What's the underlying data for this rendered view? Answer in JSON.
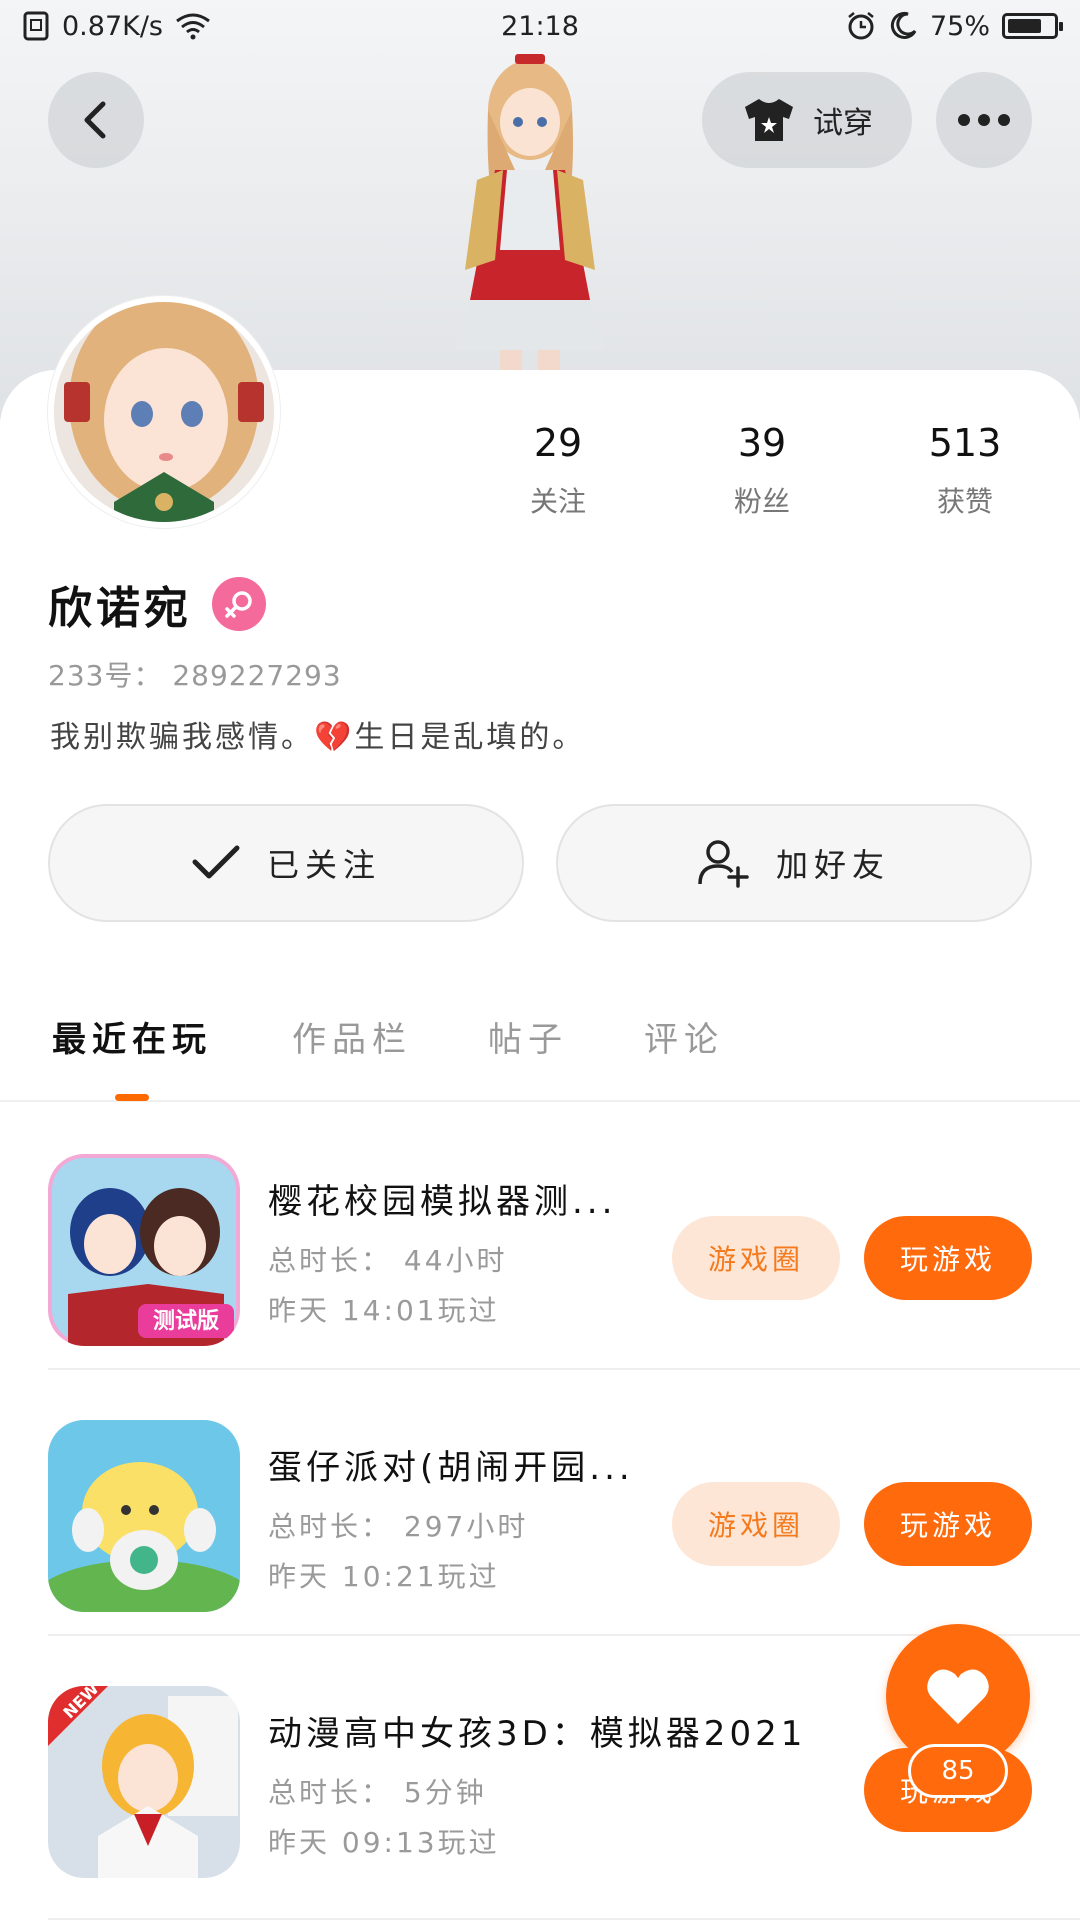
{
  "status_bar": {
    "network_speed": "0.87K/s",
    "time": "21:18",
    "battery": "75%",
    "battery_level": 0.75
  },
  "header": {
    "tryon_label": "试穿"
  },
  "profile": {
    "name": "欣诺宛",
    "uid": "233号： 289227293",
    "bio": "我别欺骗我感情。💔生日是乱填的。",
    "stats": [
      {
        "value": "29",
        "label": "关注"
      },
      {
        "value": "39",
        "label": "粉丝"
      },
      {
        "value": "513",
        "label": "获赞"
      }
    ]
  },
  "actions": {
    "followed_label": "已关注",
    "add_friend_label": "加好友"
  },
  "tabs": [
    {
      "label": "最近在玩",
      "active": true
    },
    {
      "label": "作品栏",
      "active": false
    },
    {
      "label": "帖子",
      "active": false
    },
    {
      "label": "评论",
      "active": false
    }
  ],
  "games": [
    {
      "title": "樱花校园模拟器测...",
      "total_time": "总时长： 44小时",
      "last_played": "昨天 14:01玩过",
      "circle_label": "游戏圈",
      "play_label": "玩游戏",
      "icon_badge": "测试版"
    },
    {
      "title": "蛋仔派对(胡闹开园...",
      "total_time": "总时长： 297小时",
      "last_played": "昨天 10:21玩过",
      "circle_label": "游戏圈",
      "play_label": "玩游戏",
      "icon_badge": ""
    },
    {
      "title": "动漫高中女孩3D：模拟器2021",
      "total_time": "总时长： 5分钟",
      "last_played": "昨天 09:13玩过",
      "circle_label": "",
      "play_label": "玩游戏",
      "icon_badge": "NEW"
    }
  ],
  "like": {
    "count": "85"
  },
  "colors": {
    "accent": "#ff6a0d",
    "accent_light": "#fde6d6",
    "gender_badge": "#f46a9b"
  }
}
